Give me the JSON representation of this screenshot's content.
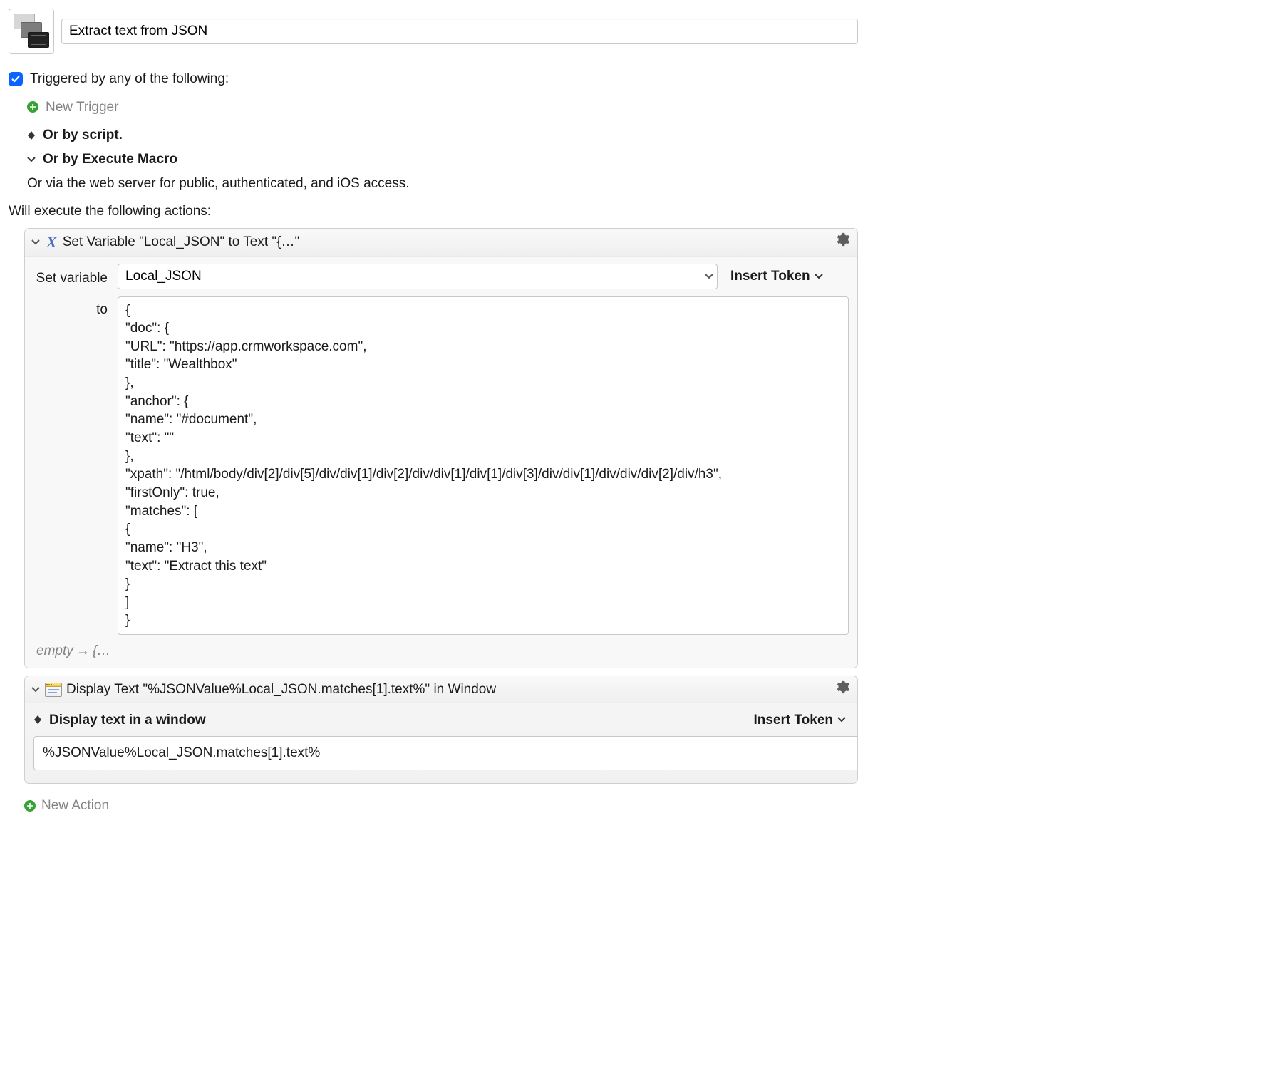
{
  "header": {
    "macro_name": "Extract text from JSON"
  },
  "triggers": {
    "label": "Triggered by any of the following:",
    "new_trigger_label": "New Trigger",
    "or_by_script": "Or by script.",
    "or_by_execute_macro": "Or by Execute Macro",
    "or_via_web": "Or via the web server for public, authenticated, and iOS access."
  },
  "actions_label": "Will execute the following actions:",
  "action1": {
    "title": "Set Variable \"Local_JSON\" to Text \"{…\"",
    "set_variable_label": "Set variable",
    "variable_name": "Local_JSON",
    "insert_token": "Insert Token",
    "to_label": "to",
    "text_value": "{\n\"doc\": {\n\"URL\": \"https://app.crmworkspace.com\",\n\"title\": \"Wealthbox\"\n},\n\"anchor\": {\n\"name\": \"#document\",\n\"text\": \"\"\n},\n\"xpath\": \"/html/body/div[2]/div[5]/div/div[1]/div[2]/div/div[1]/div[1]/div[3]/div/div[1]/div/div/div[2]/div/h3\",\n\"firstOnly\": true,\n\"matches\": [\n{\n\"name\": \"H3\",\n\"text\": \"Extract this text\"\n}\n]\n}",
    "hint_empty": "empty",
    "hint_curly": "{…"
  },
  "action2": {
    "title": "Display Text \"%JSONValue%Local_JSON.matches[1].text%\" in Window",
    "subtitle": "Display text in a window",
    "insert_token": "Insert Token",
    "value": "%JSONValue%Local_JSON.matches[1].text%"
  },
  "footer": {
    "new_action_label": "New Action"
  }
}
